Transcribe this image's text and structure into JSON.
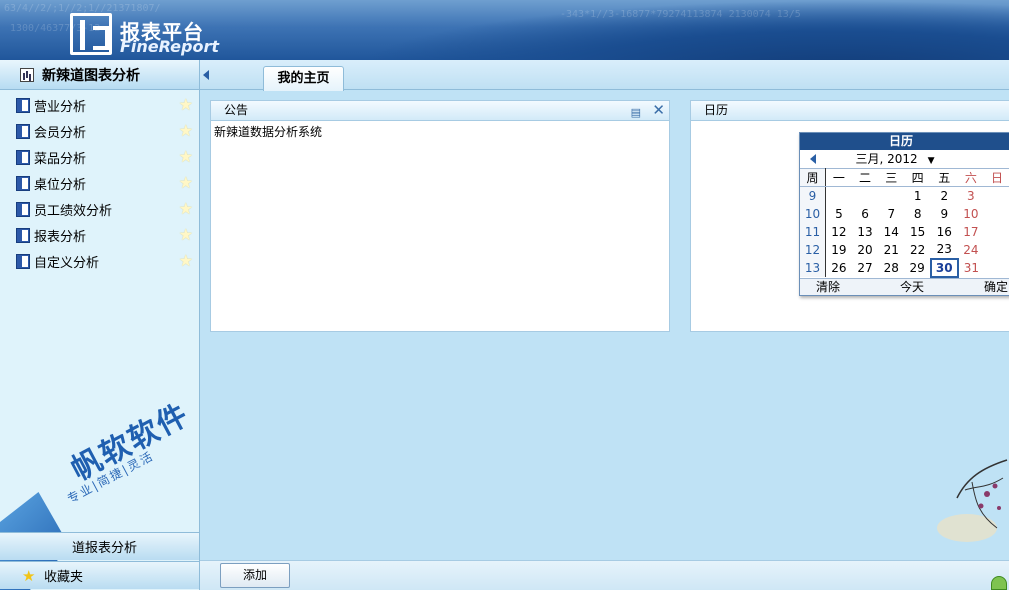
{
  "header": {
    "logo_cn": "报表平台",
    "logo_en": "FineReport",
    "bg_numbers": [
      "63/4//2/;1//2;1//21371807/",
      "-343*1//3-16877*79274113874 2130074 13/5",
      "1300/46377/3-12"
    ]
  },
  "sidebar": {
    "title": "新辣道图表分析",
    "items": [
      {
        "label": "营业分析"
      },
      {
        "label": "会员分析"
      },
      {
        "label": "菜品分析"
      },
      {
        "label": "桌位分析"
      },
      {
        "label": "员工绩效分析"
      },
      {
        "label": "报表分析"
      },
      {
        "label": "自定义分析"
      }
    ],
    "brand_big": "帆软软件",
    "brand_sub": "专业|简捷|灵活",
    "bottom1": "道报表分析",
    "bottom2": "收藏夹"
  },
  "tabs": [
    {
      "label": "我的主页"
    }
  ],
  "announcement": {
    "title": "公告",
    "body": "新辣道数据分析系统"
  },
  "calendar_panel": {
    "title": "日历"
  },
  "calendar": {
    "title": "日历",
    "month_label": "三月, 2012",
    "week_header": "周",
    "weekdays": [
      "一",
      "二",
      "三",
      "四",
      "五",
      "六",
      "日"
    ],
    "rows": [
      {
        "week": "9",
        "days": [
          "",
          "",
          "",
          "1",
          "2",
          "3",
          ""
        ]
      },
      {
        "week": "10",
        "days": [
          "5",
          "6",
          "7",
          "8",
          "9",
          "10",
          ""
        ]
      },
      {
        "week": "11",
        "days": [
          "12",
          "13",
          "14",
          "15",
          "16",
          "17",
          ""
        ]
      },
      {
        "week": "12",
        "days": [
          "19",
          "20",
          "21",
          "22",
          "23",
          "24",
          ""
        ]
      },
      {
        "week": "13",
        "days": [
          "26",
          "27",
          "28",
          "29",
          "30",
          "31",
          ""
        ]
      }
    ],
    "today": "30",
    "clear_label": "清除",
    "today_label": "今天",
    "ok_label": "确定"
  },
  "bottom": {
    "add_label": "添加"
  },
  "colors": {
    "header_dark": "#20569b",
    "sidebar_bg": "#dff3fb",
    "main_bg": "#bfe2f5",
    "calendar_title": "#1f4f8c",
    "weekend": "#c25050"
  }
}
